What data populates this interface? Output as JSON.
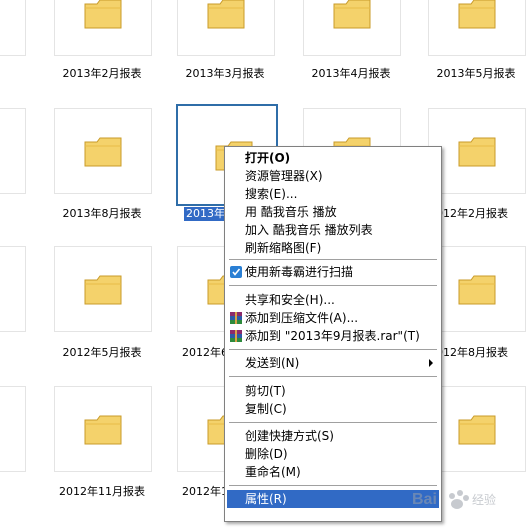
{
  "folders": [
    {
      "name": "报表"
    },
    {
      "name": "2013年2月报表"
    },
    {
      "name": "2013年3月报表"
    },
    {
      "name": "2013年4月报表"
    },
    {
      "name": "2013年5月报表"
    },
    {
      "name": "报表"
    },
    {
      "name": "2013年8月报表"
    },
    {
      "name": "2013年9"
    },
    {
      "name": "012年2月报表"
    },
    {
      "name": "报表"
    },
    {
      "name": "2012年5月报表"
    },
    {
      "name": "2012年6"
    },
    {
      "name": "012年8月报表"
    },
    {
      "name": "报表"
    },
    {
      "name": "2012年11月报表"
    },
    {
      "name": "2012年1"
    }
  ],
  "context_menu": {
    "items": [
      {
        "label": "打开(O)",
        "bold": true
      },
      {
        "label": "资源管理器(X)"
      },
      {
        "label": "搜索(E)..."
      },
      {
        "label": "用 酷我音乐 播放"
      },
      {
        "label": "加入 酷我音乐 播放列表"
      },
      {
        "label": "刷新缩略图(F)"
      },
      {
        "label": "使用新毒霸进行扫描",
        "icon": "antivirus-shield-icon"
      },
      {
        "label": "共享和安全(H)..."
      },
      {
        "label": "添加到压缩文件(A)...",
        "icon": "winrar-archive-icon"
      },
      {
        "label": "添加到 \"2013年9月报表.rar\"(T)",
        "icon": "winrar-archive-icon"
      },
      {
        "label": "发送到(N)",
        "submenu": true
      },
      {
        "label": "剪切(T)"
      },
      {
        "label": "复制(C)"
      },
      {
        "label": "创建快捷方式(S)"
      },
      {
        "label": "删除(D)"
      },
      {
        "label": "重命名(M)"
      },
      {
        "label": "属性(R)",
        "highlighted": true
      }
    ]
  },
  "colors": {
    "selection": "#316ac5",
    "folder_fill": "#f4d26b",
    "folder_edge": "#c99b2a"
  },
  "watermark": {
    "text": "Bai百度经验"
  }
}
